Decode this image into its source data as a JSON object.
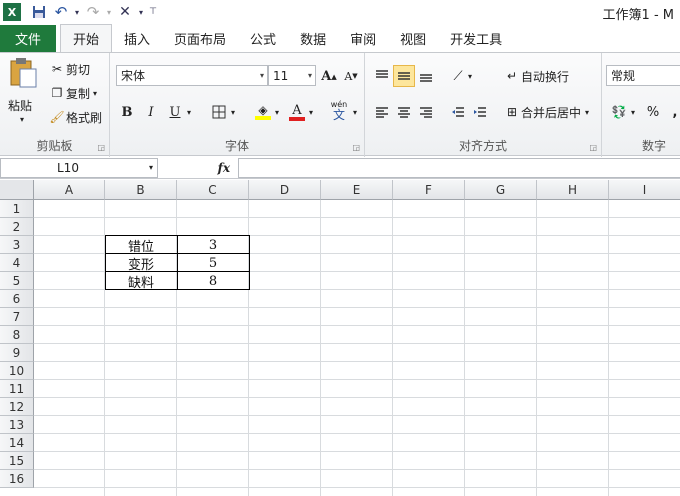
{
  "window": {
    "title": "工作簿1 - M",
    "app_icon": "X"
  },
  "qat": {
    "save_icon": "💾",
    "undo_icon": "↶",
    "redo_icon": "↷",
    "customize_icon": "▾"
  },
  "tabs": {
    "file": "文件",
    "items": [
      "开始",
      "插入",
      "页面布局",
      "公式",
      "数据",
      "审阅",
      "视图",
      "开发工具"
    ]
  },
  "clipboard": {
    "paste": "粘贴",
    "cut": "剪切",
    "copy": "复制",
    "format_painter": "格式刷",
    "label": "剪贴板"
  },
  "font": {
    "name": "宋体",
    "size": "11",
    "bold": "B",
    "italic": "I",
    "underline": "U",
    "label": "字体",
    "grow": "A",
    "shrink": "A",
    "font_color": "A",
    "phonetic": "wén"
  },
  "alignment": {
    "wrap_text": "自动换行",
    "merge_center": "合并后居中",
    "label": "对齐方式"
  },
  "number": {
    "format": "常规",
    "percent": "%",
    "label": "数字"
  },
  "formula_bar": {
    "name_box": "L10",
    "fx": "fx",
    "value": ""
  },
  "grid": {
    "columns": [
      "A",
      "B",
      "C",
      "D",
      "E",
      "F",
      "G",
      "H",
      "I"
    ],
    "rows": [
      "1",
      "2",
      "3",
      "4",
      "5",
      "6",
      "7",
      "8",
      "9",
      "10",
      "11",
      "12",
      "13",
      "14",
      "15",
      "16"
    ],
    "cells": [
      {
        "col": "B",
        "row": 3,
        "value": "错位"
      },
      {
        "col": "C",
        "row": 3,
        "value": "3"
      },
      {
        "col": "B",
        "row": 4,
        "value": "变形"
      },
      {
        "col": "C",
        "row": 4,
        "value": "5"
      },
      {
        "col": "B",
        "row": 5,
        "value": "缺料"
      },
      {
        "col": "C",
        "row": 5,
        "value": "8"
      }
    ]
  },
  "colors": {
    "file_tab": "#1f7a3c",
    "highlight": "#ffff00",
    "font_red": "#e02020"
  }
}
